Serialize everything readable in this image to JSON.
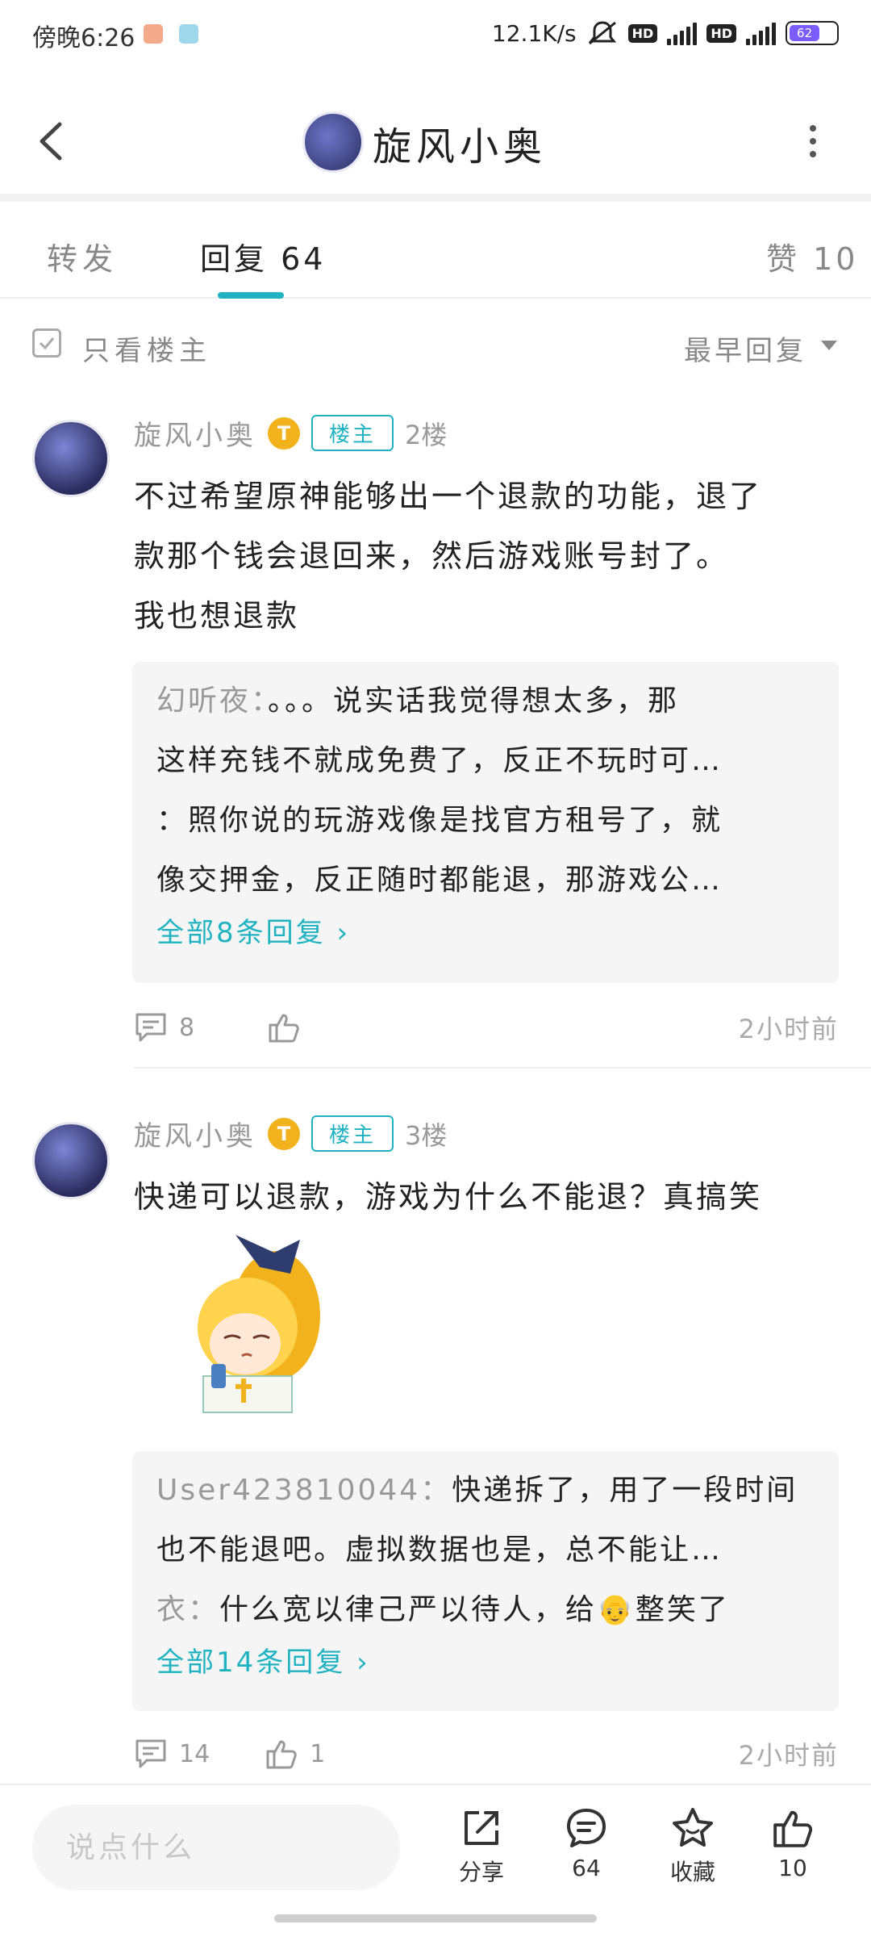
{
  "status_bar": {
    "time": "傍晚6:26",
    "net_speed": "12.1K/s",
    "hd1": "HD",
    "hd2": "HD",
    "battery": "62"
  },
  "header": {
    "title": "旋风小奥"
  },
  "tabs": [
    {
      "label": "转发"
    },
    {
      "label": "回复 64"
    },
    {
      "label": "赞 10"
    }
  ],
  "filter": {
    "only_op_label": "只看楼主",
    "sort_label": "最早回复"
  },
  "posts": [
    {
      "author": "旋风小奥",
      "level_badge": "T",
      "op_badge": "楼主",
      "floor": "2楼",
      "content_lines": [
        "不过希望原神能够出一个退款的功能，退了",
        "款那个钱会退回来，然后游戏账号封了。",
        "我也想退款"
      ],
      "quotes": [
        {
          "user": "幻听夜：",
          "text": "。。。说实话我觉得想太多，那"
        },
        {
          "user": "",
          "text": "这样充钱不就成免费了，反正不玩时可…"
        },
        {
          "user": "",
          "text": "：照你说的玩游戏像是找官方租号了，就"
        },
        {
          "user": "",
          "text": "像交押金，反正随时都能退，那游戏公…"
        }
      ],
      "more_replies": "全部8条回复",
      "comment_count": "8",
      "like_count": "",
      "time": "2小时前"
    },
    {
      "author": "旋风小奥",
      "level_badge": "T",
      "op_badge": "楼主",
      "floor": "3楼",
      "content_lines": [
        "快递可以退款，游戏为什么不能退？真搞笑"
      ],
      "quotes": [
        {
          "user": "User423810044：",
          "text": "快递拆了，用了一段时间"
        },
        {
          "user": "",
          "text": "也不能退吧。虚拟数据也是，总不能让…"
        },
        {
          "user": "衣：",
          "text": "什么宽以律己严以待人，给👴整笑了"
        }
      ],
      "more_replies": "全部14条回复",
      "comment_count": "14",
      "like_count": "1",
      "time": "2小时前"
    }
  ],
  "bottom_bar": {
    "input_placeholder": "说点什么",
    "share_label": "分享",
    "comments_label": "64",
    "favorite_label": "收藏",
    "likes_label": "10"
  },
  "colors": {
    "accent": "#1fb3c2",
    "badge_gold": "#f2b21c",
    "muted_text": "#999999"
  }
}
